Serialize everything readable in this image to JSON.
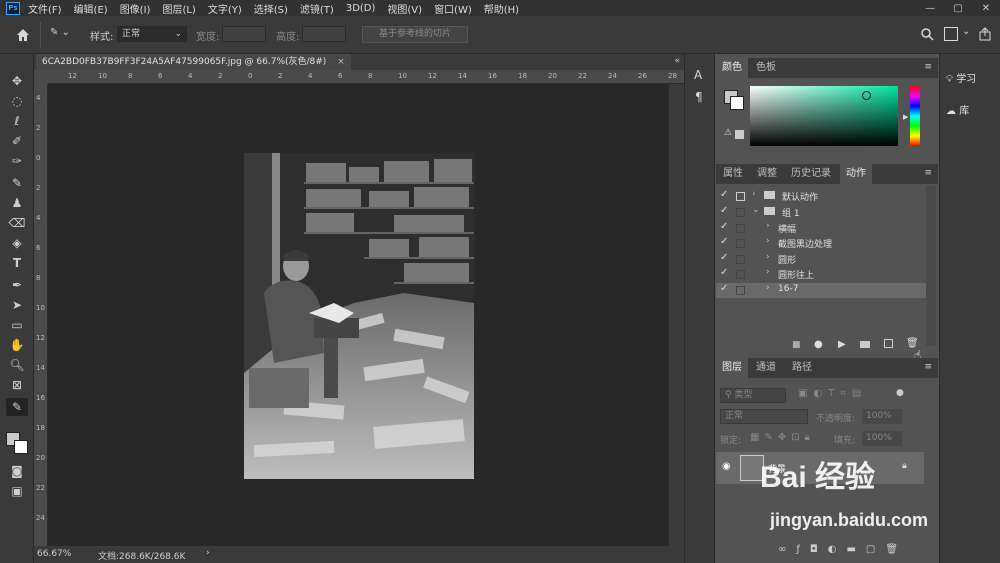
{
  "menu": [
    "文件(F)",
    "编辑(E)",
    "图像(I)",
    "图层(L)",
    "文字(Y)",
    "选择(S)",
    "滤镜(T)",
    "3D(D)",
    "视图(V)",
    "窗口(W)",
    "帮助(H)"
  ],
  "app_logo": "Ps",
  "options": {
    "style_label": "样式:",
    "style_value": "正常",
    "width_label": "宽度:",
    "height_label": "高度:",
    "guides_button": "基于参考线的切片"
  },
  "document": {
    "tab_title": "6CA2BD0FB37B9FF3F24A5AF47599065F.jpg @ 66.7%(灰色/8#)",
    "zoom": "66.67%",
    "doc_info": "文档:268.6K/268.6K"
  },
  "ruler_h_ticks": [
    "12",
    "10",
    "8",
    "6",
    "4",
    "2",
    "0",
    "2",
    "4",
    "6",
    "8",
    "10",
    "12",
    "14",
    "16",
    "18",
    "20",
    "22",
    "24",
    "26",
    "28"
  ],
  "ruler_v_ticks": [
    "4",
    "2",
    "0",
    "2",
    "4",
    "6",
    "8",
    "10",
    "12",
    "14",
    "16",
    "18",
    "20",
    "22",
    "24"
  ],
  "side_small": {
    "a_icon": "A",
    "para_icon": "¶"
  },
  "color_panel": {
    "tabs": [
      "颜色",
      "色板"
    ]
  },
  "actions_panel": {
    "tabs": [
      "属性",
      "调整",
      "历史记录",
      "动作"
    ],
    "rows": [
      {
        "label": "默认动作",
        "type": "set",
        "expanded": false
      },
      {
        "label": "组 1",
        "type": "set",
        "expanded": true
      },
      {
        "label": "横幅",
        "type": "action"
      },
      {
        "label": "截图黑边处理",
        "type": "action"
      },
      {
        "label": "圆形",
        "type": "action"
      },
      {
        "label": "圆形往上",
        "type": "action"
      },
      {
        "label": "16-7",
        "type": "action",
        "selected": true
      }
    ]
  },
  "layers_panel": {
    "tabs": [
      "图层",
      "通道",
      "路径"
    ],
    "filter": "类型",
    "blend_mode": "正常",
    "opacity_label": "不透明度:",
    "opacity_value": "100%",
    "lock_label": "锁定:",
    "fill_label": "填充:",
    "fill_value": "100%",
    "layer_name": "背景"
  },
  "right_items": {
    "learn": "学习",
    "library": "库"
  },
  "watermark": {
    "brand": "Bai 经验",
    "url": "jingyan.baidu.com"
  },
  "colors": {
    "accent": "#31a8ff",
    "panel": "#535353",
    "dark": "#3a3a3a"
  }
}
